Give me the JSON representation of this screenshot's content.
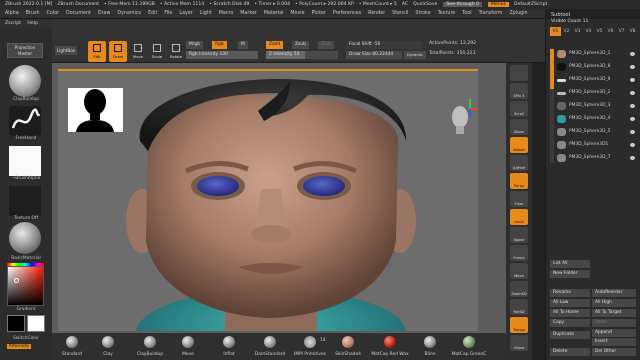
{
  "titlebar": {
    "app": "ZBrush 2022.0.1 [M]",
    "doc": "ZBrush Document",
    "free_mem": "• Free Mem 11.289GB",
    "active_mem": "• Active Mem 1114",
    "scratch": "• Scratch Disk 49",
    "timer": "• Timer ▸ 0.004",
    "polycount": "• PolyCount ▸ 292.004 KP",
    "meshcount": "• MeshCount ▸ 5",
    "ac": "AC",
    "quicksave": "QuickSave",
    "see_through": "See-through 0",
    "menus": "Menus",
    "script": "DefaultZScript"
  },
  "menubar": {
    "items": [
      "Alpha",
      "Brush",
      "Color",
      "Document",
      "Draw",
      "Dynamics",
      "Edit",
      "File",
      "Layer",
      "Light",
      "Macro",
      "Marker",
      "Material",
      "Movie",
      "Picker",
      "Preferences",
      "Render",
      "Stencil",
      "Stroke",
      "Texture",
      "Tool",
      "Transform",
      "Zplugin"
    ],
    "sub_items": [
      "Zscript",
      "Help"
    ]
  },
  "left_tray": {
    "projection_master": "Projection Master",
    "brush_label": "ClayBuildup",
    "stroke_label": "FreeHand",
    "alpha_label": "~BrushAlpha",
    "texture_label": "Texture Off",
    "material_label": "BasicMaterial",
    "gradient_label": "Gradient",
    "switch_label": "SwitchColor",
    "alternate_label": "Alternate"
  },
  "shelf": {
    "lightbox": "LightBox",
    "edit": "Edit",
    "draw": "Draw",
    "move": "Move",
    "scale": "Scale",
    "rotate": "Rotate",
    "mrgb": "Mrgb",
    "rgb": "Rgb",
    "m": "M",
    "rgb_intensity": "Rgb Intensity 100",
    "zadd": "Zadd",
    "zsub": "Zsub",
    "zcut": "Zcut",
    "z_intensity": "Z Intensity 54",
    "z_intensity_value": 54,
    "focal_shift": "Focal Shift -56",
    "draw_size": "Draw Size 80.22444",
    "dynamic": "Dynamic",
    "active_points": "ActivePoints: 12,292",
    "total_points": "TotalPoints: 350,223"
  },
  "right_toolbar": [
    "SPix 3",
    "Scroll",
    "Zoom",
    "Actual",
    "AAHalf",
    "Persp",
    "Floor",
    "Local",
    "Xpose",
    "Frame",
    "Move",
    "ZoomSD",
    "RotSD",
    "Transp",
    "Ghost",
    "Solo"
  ],
  "subtool": {
    "title": "Subtool",
    "visible_count": "Visible Count 11",
    "versions": [
      "V1",
      "V2",
      "V3",
      "V4",
      "V5",
      "V6",
      "V7",
      "V8"
    ],
    "items": [
      "PM3D_Sphere3D_1",
      "PM3D_Sphere3D_8",
      "PM3D_Sphere3D_9",
      "PM3D_Sphere3D_2",
      "PM3D_Sphere3D_3",
      "PM3D_Sphere3D_4",
      "PM3D_Sphere3D_5",
      "PM3D_Sphere3D1",
      "PM3D_Sphere3D_7"
    ],
    "list_all": "List All",
    "new_folder": "New Folder",
    "rename": "Rename",
    "auto_reorder": "AutoReorder",
    "all_low": "All Low",
    "all_high": "All High",
    "all_to_home": "All To Home",
    "all_to_target": "All To Target",
    "copy": "Copy",
    "paste": "Paste",
    "duplicate": "Duplicate",
    "append": "Append",
    "insert": "Insert",
    "delete": "Delete",
    "del_other": "Del Other"
  },
  "bottom_shelf": [
    "Standard",
    "Clay",
    "ClayBuildup",
    "Move",
    "Inflat",
    "DamStandard",
    "IMM Primitives",
    "SkinShade4",
    "MatCap Red Wax",
    "Blinn",
    "MatCap GreenC"
  ],
  "bottom_counter": "14",
  "colors": {
    "accent": "#e88a1a",
    "panel": "#2b2b2b",
    "canvas": "#6d6d6d"
  }
}
